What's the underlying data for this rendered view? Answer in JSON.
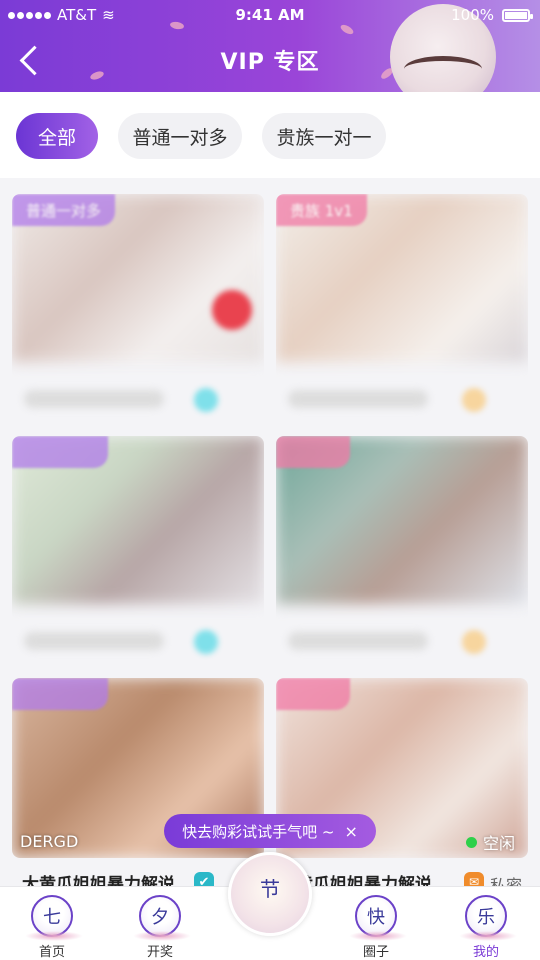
{
  "status_bar": {
    "carrier": "AT&T",
    "time": "9:41 AM",
    "battery": "100%"
  },
  "header": {
    "title": "VIP 专区",
    "back_icon": "chevron-left-icon"
  },
  "filters": [
    {
      "label": "全部",
      "active": true
    },
    {
      "label": "普通一对多",
      "active": false
    },
    {
      "label": "贵族一对一",
      "active": false
    }
  ],
  "cards": [
    {
      "tag": "普通一对多"
    },
    {
      "tag": "贵族 1v1"
    }
  ],
  "bottom_cards": {
    "left_overlay": "DERGD",
    "left_title": "大黄瓜姐姐暴力解说",
    "right_title": "大黄瓜姐姐暴力解说",
    "right_visible_title": "黄瓜姐姐暴力解说",
    "status": "空闲",
    "private_label": "私密"
  },
  "toast": {
    "text": "快去购彩试试手气吧 ~",
    "close": "×"
  },
  "tabbar": [
    {
      "glyph": "七",
      "label": "首页"
    },
    {
      "glyph": "夕",
      "label": "开奖"
    },
    {
      "glyph": "节",
      "label": ""
    },
    {
      "glyph": "快",
      "label": "圈子"
    },
    {
      "glyph": "乐",
      "label": "我的"
    }
  ],
  "colors": {
    "accent": "#7b3bd6",
    "online": "#2ed04a"
  }
}
